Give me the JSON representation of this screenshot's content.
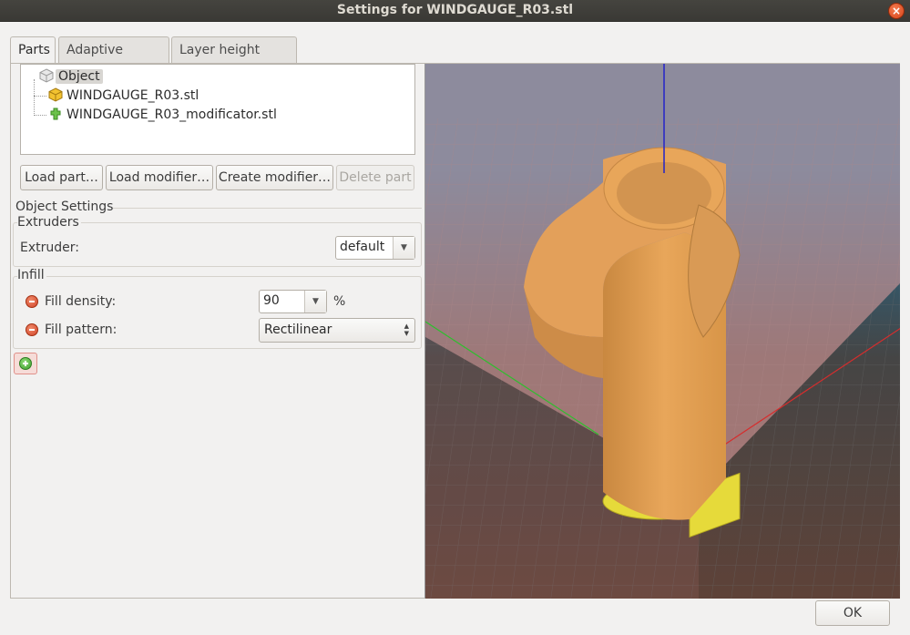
{
  "window": {
    "title": "Settings for WINDGAUGE_R03.stl"
  },
  "tabs": [
    {
      "label": "Parts",
      "active": true
    },
    {
      "label": "Adaptive Layers",
      "active": false
    },
    {
      "label": "Layer height table",
      "active": false
    }
  ],
  "tree": {
    "root": "Object",
    "children": [
      {
        "label": "WINDGAUGE_R03.stl",
        "icon": "part-icon"
      },
      {
        "label": "WINDGAUGE_R03_modificator.stl",
        "icon": "modifier-icon"
      }
    ]
  },
  "part_buttons": {
    "load_part": "Load part…",
    "load_modifier": "Load modifier…",
    "create_modifier": "Create modifier…",
    "delete_part": "Delete part"
  },
  "object_settings": {
    "title": "Object Settings",
    "extruders": {
      "title": "Extruders",
      "extruder_label": "Extruder:",
      "extruder_value": "default"
    },
    "infill": {
      "title": "Infill",
      "fill_density_label": "Fill density:",
      "fill_density_value": "90",
      "fill_density_unit": "%",
      "fill_pattern_label": "Fill pattern:",
      "fill_pattern_value": "Rectilinear"
    }
  },
  "colors": {
    "part": "#e8a65a",
    "modifier": "#e6da3a",
    "bed": "#4a4a4a",
    "axis_x": "#d62d2d",
    "axis_y": "#2dbf2d",
    "axis_z": "#2323c8"
  },
  "footer": {
    "ok_label": "OK"
  }
}
